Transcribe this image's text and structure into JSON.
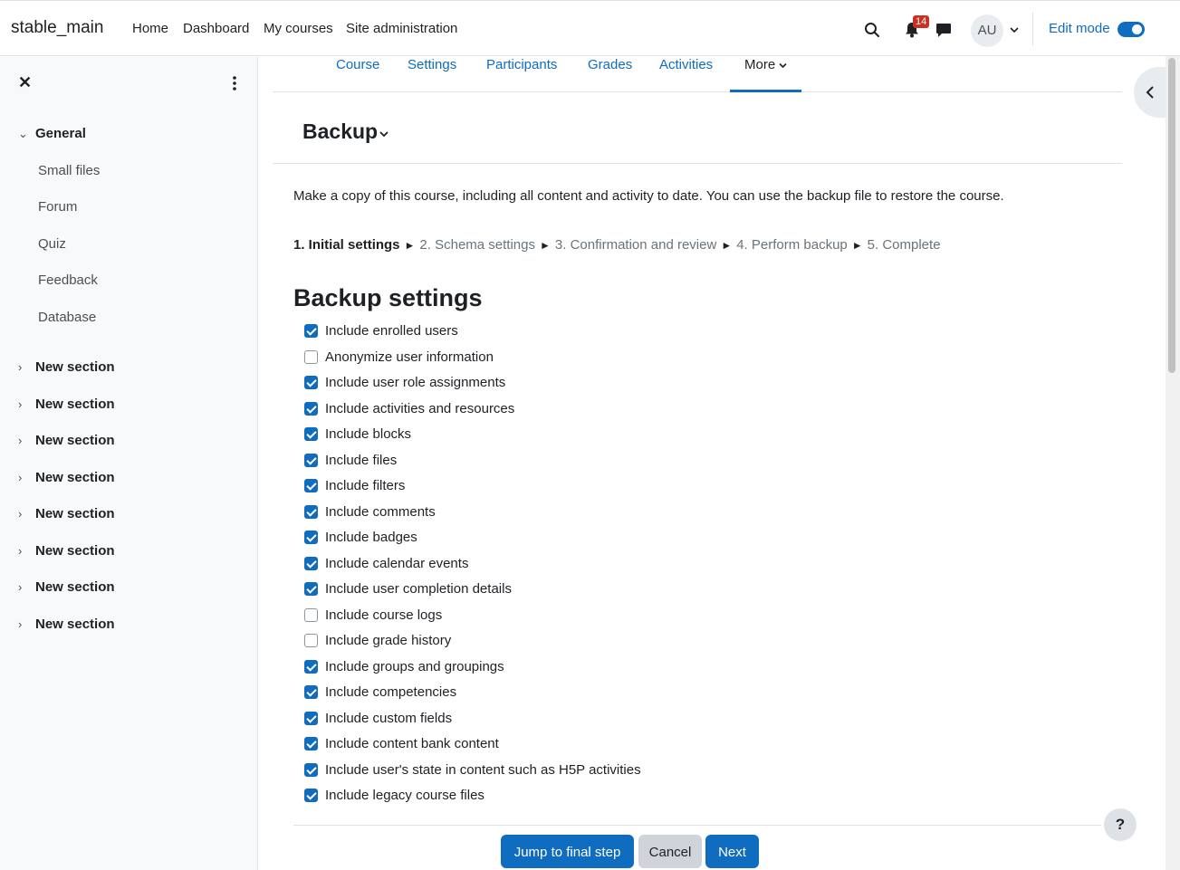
{
  "header": {
    "site_name": "stable_main",
    "nav": [
      "Home",
      "Dashboard",
      "My courses",
      "Site administration"
    ],
    "notification_count": "14",
    "avatar_initials": "AU",
    "edit_mode_label": "Edit mode",
    "edit_mode_on": true
  },
  "drawer": {
    "close_icon": "close-icon",
    "general_label": "General",
    "activities": [
      "Small files",
      "Forum",
      "Quiz",
      "Feedback",
      "Database"
    ],
    "sections": [
      "New section",
      "New section",
      "New section",
      "New section",
      "New section",
      "New section",
      "New section",
      "New section"
    ]
  },
  "tabs": [
    "Course",
    "Settings",
    "Participants",
    "Grades",
    "Activities",
    "More"
  ],
  "page": {
    "title": "Backup",
    "intro": "Make a copy of this course, including all content and activity to date. You can use the backup file to restore the course.",
    "steps": [
      "1. Initial settings",
      "2. Schema settings",
      "3. Confirmation and review",
      "4. Perform backup",
      "5. Complete"
    ],
    "step_separator": "►",
    "settings_heading": "Backup settings"
  },
  "options": [
    {
      "label": "Include enrolled users",
      "checked": true
    },
    {
      "label": "Anonymize user information",
      "checked": false
    },
    {
      "label": "Include user role assignments",
      "checked": true
    },
    {
      "label": "Include activities and resources",
      "checked": true
    },
    {
      "label": "Include blocks",
      "checked": true
    },
    {
      "label": "Include files",
      "checked": true
    },
    {
      "label": "Include filters",
      "checked": true
    },
    {
      "label": "Include comments",
      "checked": true
    },
    {
      "label": "Include badges",
      "checked": true
    },
    {
      "label": "Include calendar events",
      "checked": true
    },
    {
      "label": "Include user completion details",
      "checked": true
    },
    {
      "label": "Include course logs",
      "checked": false
    },
    {
      "label": "Include grade history",
      "checked": false
    },
    {
      "label": "Include groups and groupings",
      "checked": true
    },
    {
      "label": "Include competencies",
      "checked": true
    },
    {
      "label": "Include custom fields",
      "checked": true
    },
    {
      "label": "Include content bank content",
      "checked": true
    },
    {
      "label": "Include user's state in content such as H5P activities",
      "checked": true
    },
    {
      "label": "Include legacy course files",
      "checked": true
    }
  ],
  "buttons": {
    "jump": "Jump to final step",
    "cancel": "Cancel",
    "next": "Next"
  },
  "help_label": "?",
  "colors": {
    "primary": "#0f6cbf",
    "badge": "#ca3120"
  }
}
